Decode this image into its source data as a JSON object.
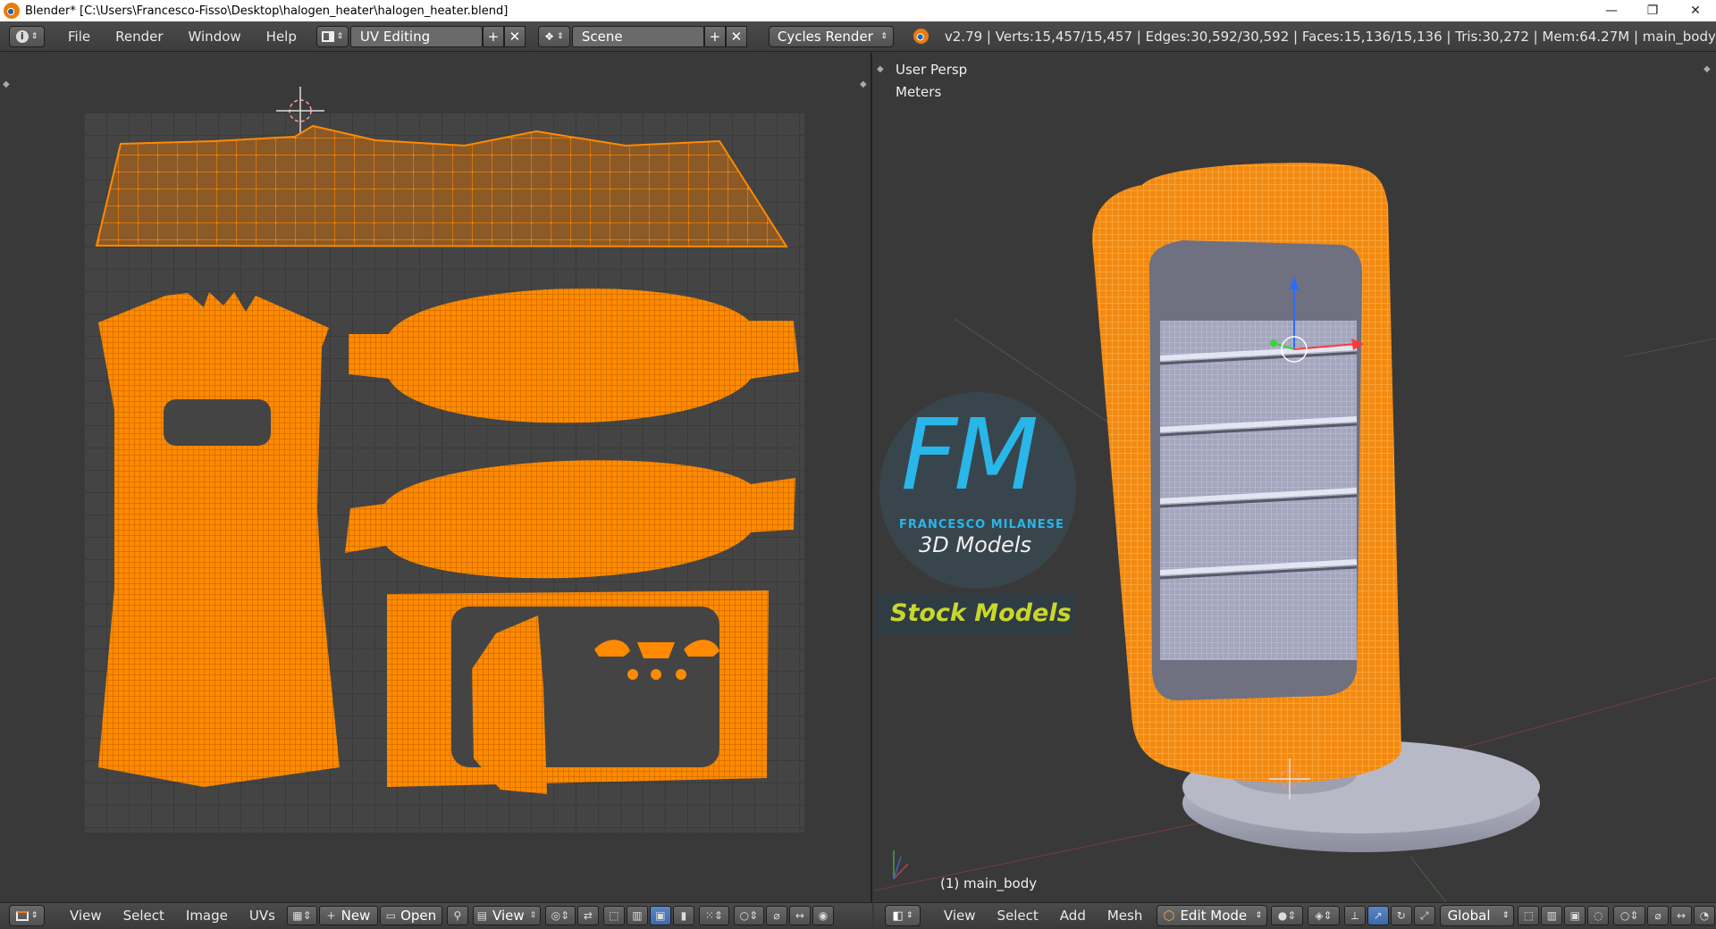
{
  "window": {
    "title": "Blender* [C:\\Users\\Francesco-Fisso\\Desktop\\halogen_heater\\halogen_heater.blend]",
    "minimize": "—",
    "restore": "❐",
    "close": "✕"
  },
  "menu": [
    "File",
    "Render",
    "Window",
    "Help"
  ],
  "layout": {
    "label": "UV Editing"
  },
  "scene": {
    "label": "Scene"
  },
  "render_engine": "Cycles Render",
  "stats": "v2.79 | Verts:15,457/15,457 | Edges:30,592/30,592 | Faces:15,136/15,136 | Tris:30,272 | Mem:64.27M | main_body",
  "viewport": {
    "view_name": "User Persp",
    "units": "Meters",
    "object_label": "(1) main_body"
  },
  "watermark": {
    "logo_letters": "FM",
    "brand": "FRANCESCO MILANESE",
    "subtitle": "3D Models",
    "banner": "Stock Models"
  },
  "uv_footer": {
    "items": [
      "View",
      "Select",
      "Image",
      "UVs"
    ],
    "new_label": "New",
    "open_label": "Open",
    "view_label": "View"
  },
  "view3d_footer": {
    "items": [
      "View",
      "Select",
      "Add",
      "Mesh"
    ],
    "mode": "Edit Mode",
    "orientation": "Global"
  },
  "colors": {
    "accent": "#ff8a00",
    "background": "#393939",
    "header": "#4b4b4b",
    "selected": "#5680c2"
  }
}
